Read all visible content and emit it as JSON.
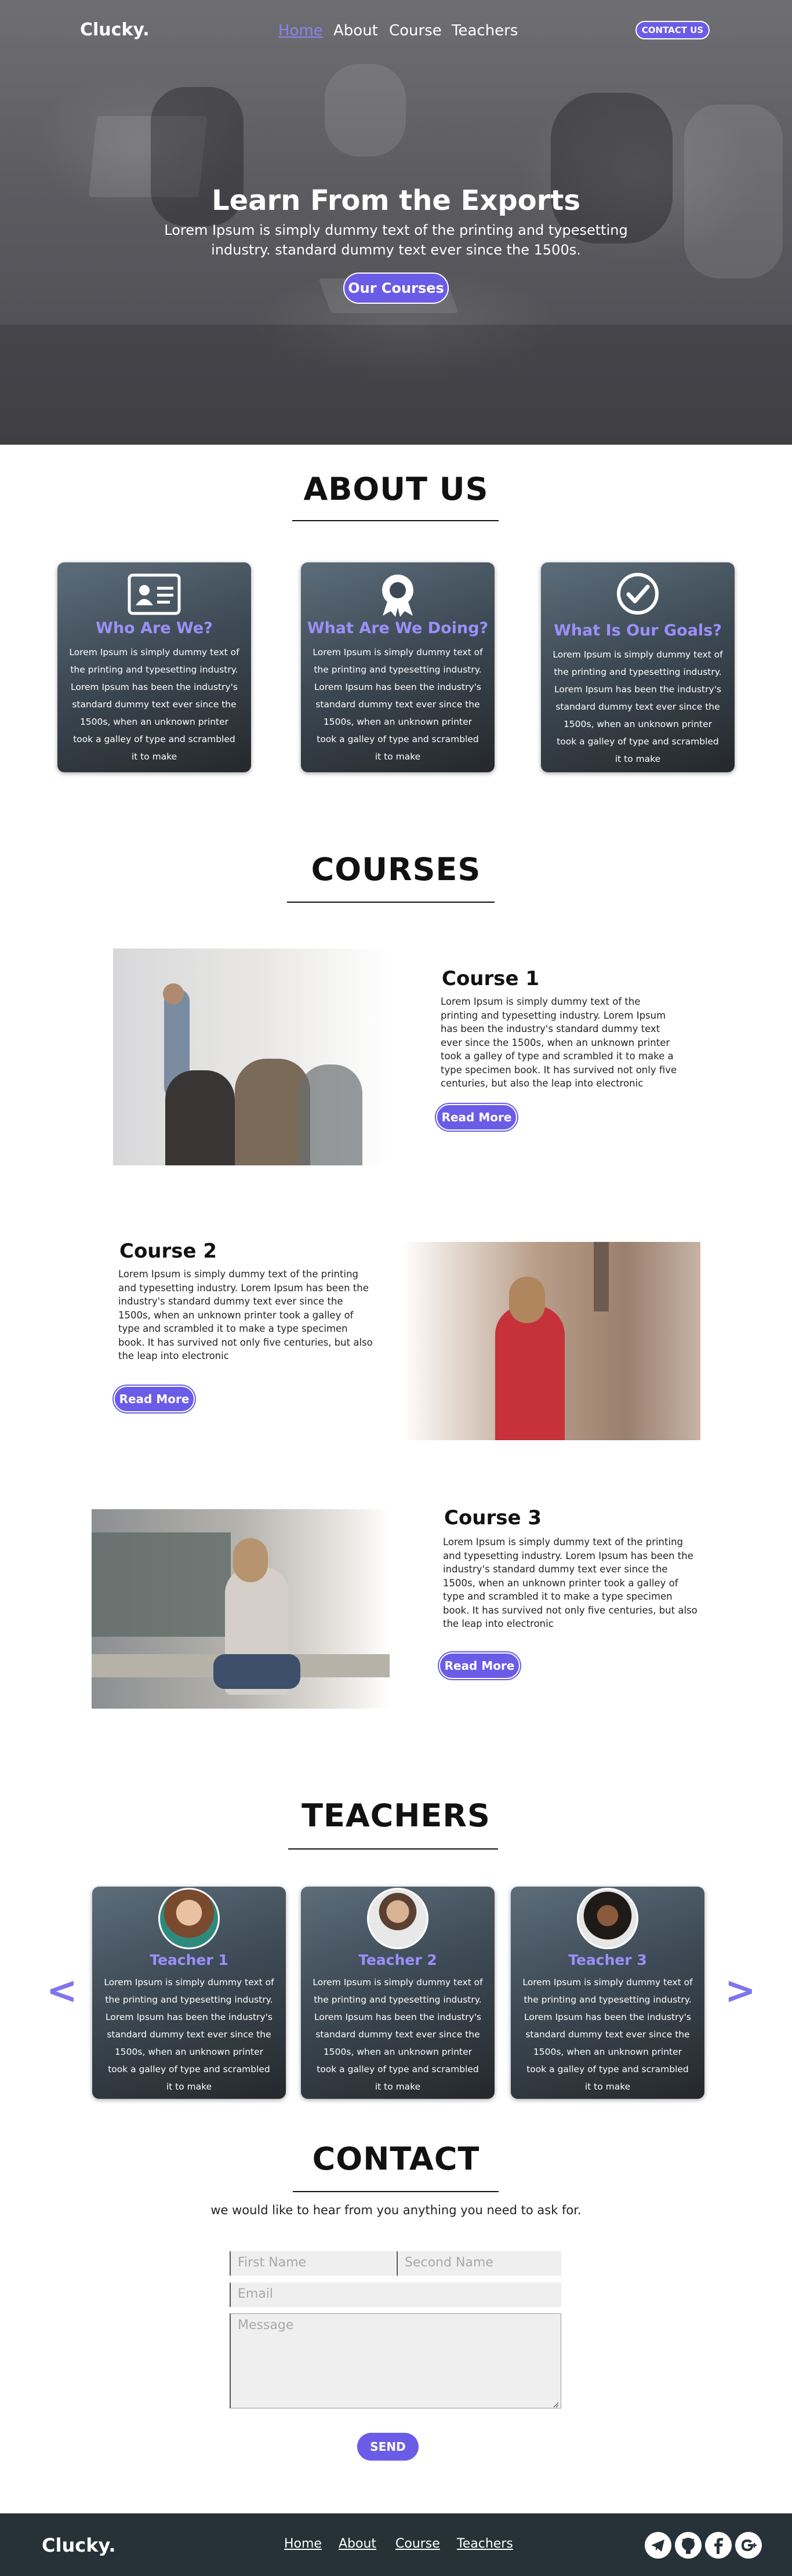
{
  "brand": "Clucky.",
  "nav": {
    "items": [
      "Home",
      "About",
      "Course",
      "Teachers"
    ],
    "active": "Home",
    "contact_button": "CONTACT US"
  },
  "hero": {
    "title": "Learn From the Exports",
    "subtitle": "Lorem Ipsum is simply dummy text of the printing and typesetting industry. standard dummy text ever since the 1500s.",
    "button": "Our Courses"
  },
  "about": {
    "title": "ABOUT US",
    "cards": [
      {
        "icon": "id-card-icon",
        "title": "Who Are We?",
        "text": "Lorem Ipsum is simply dummy text of the printing and typesetting industry. Lorem Ipsum has been the industry's standard dummy text ever since the 1500s, when an unknown printer took a galley of type and scrambled it to make"
      },
      {
        "icon": "award-ribbon-icon",
        "title": "What Are We Doing?",
        "text": "Lorem Ipsum is simply dummy text of the printing and typesetting industry. Lorem Ipsum has been the industry's standard dummy text ever since the 1500s, when an unknown printer took a galley of type and scrambled it to make"
      },
      {
        "icon": "check-circle-icon",
        "title": "What Is Our Goals?",
        "text": "Lorem Ipsum is simply dummy text of the printing and typesetting industry. Lorem Ipsum has been the industry's standard dummy text ever since the 1500s, when an unknown printer took a galley of type and scrambled it to make"
      }
    ]
  },
  "courses": {
    "title": "COURSES",
    "items": [
      {
        "title": "Course 1",
        "text": "Lorem Ipsum is simply dummy text of the printing and typesetting industry. Lorem Ipsum has been the industry's standard dummy text ever since the 1500s, when an unknown printer took a galley of type and scrambled it to make a type specimen book. It has survived not only five centuries, but also the leap into electronic",
        "button": "Read More"
      },
      {
        "title": "Course 2",
        "text": "Lorem Ipsum is simply dummy text of the printing and typesetting industry. Lorem Ipsum has been the industry's standard dummy text ever since the 1500s, when an unknown printer took a galley of type and scrambled it to make a type specimen book. It has survived not only five centuries, but also the leap into electronic",
        "button": "Read More"
      },
      {
        "title": "Course 3",
        "text": "Lorem Ipsum is simply dummy text of the printing and typesetting industry. Lorem Ipsum has been the industry's standard dummy text ever since the 1500s, when an unknown printer took a galley of type and scrambled it to make a type specimen book. It has survived not only five centuries, but also the leap into electronic",
        "button": "Read More"
      }
    ]
  },
  "teachers": {
    "title": "TEACHERS",
    "items": [
      {
        "name": "Teacher 1",
        "text": "Lorem Ipsum is simply dummy text of the printing and typesetting industry. Lorem Ipsum has been the industry's standard dummy text ever since the 1500s, when an unknown printer took a galley of type and scrambled it to make"
      },
      {
        "name": "Teacher 2",
        "text": "Lorem Ipsum is simply dummy text of the printing and typesetting industry. Lorem Ipsum has been the industry's standard dummy text ever since the 1500s, when an unknown printer took a galley of type and scrambled it to make"
      },
      {
        "name": "Teacher 3",
        "text": "Lorem Ipsum is simply dummy text of the printing and typesetting industry. Lorem Ipsum has been the industry's standard dummy text ever since the 1500s, when an unknown printer took a galley of type and scrambled it to make"
      }
    ],
    "prev_arrow": "<",
    "next_arrow": ">"
  },
  "contact": {
    "title": "CONTACT",
    "subtitle": "we would like to hear from you anything you need to ask for.",
    "placeholders": {
      "first_name": "First Name",
      "second_name": "Second Name",
      "email": "Email",
      "message": "Message"
    },
    "send": "SEND"
  },
  "footer": {
    "links": [
      "Home",
      "About",
      "Course",
      "Teachers"
    ],
    "social_icons": [
      "telegram-icon",
      "github-icon",
      "facebook-icon",
      "google-plus-icon"
    ]
  },
  "colors": {
    "accent": "#6b5ce7",
    "card_title": "#9c8ff8",
    "footer": "#263238"
  }
}
